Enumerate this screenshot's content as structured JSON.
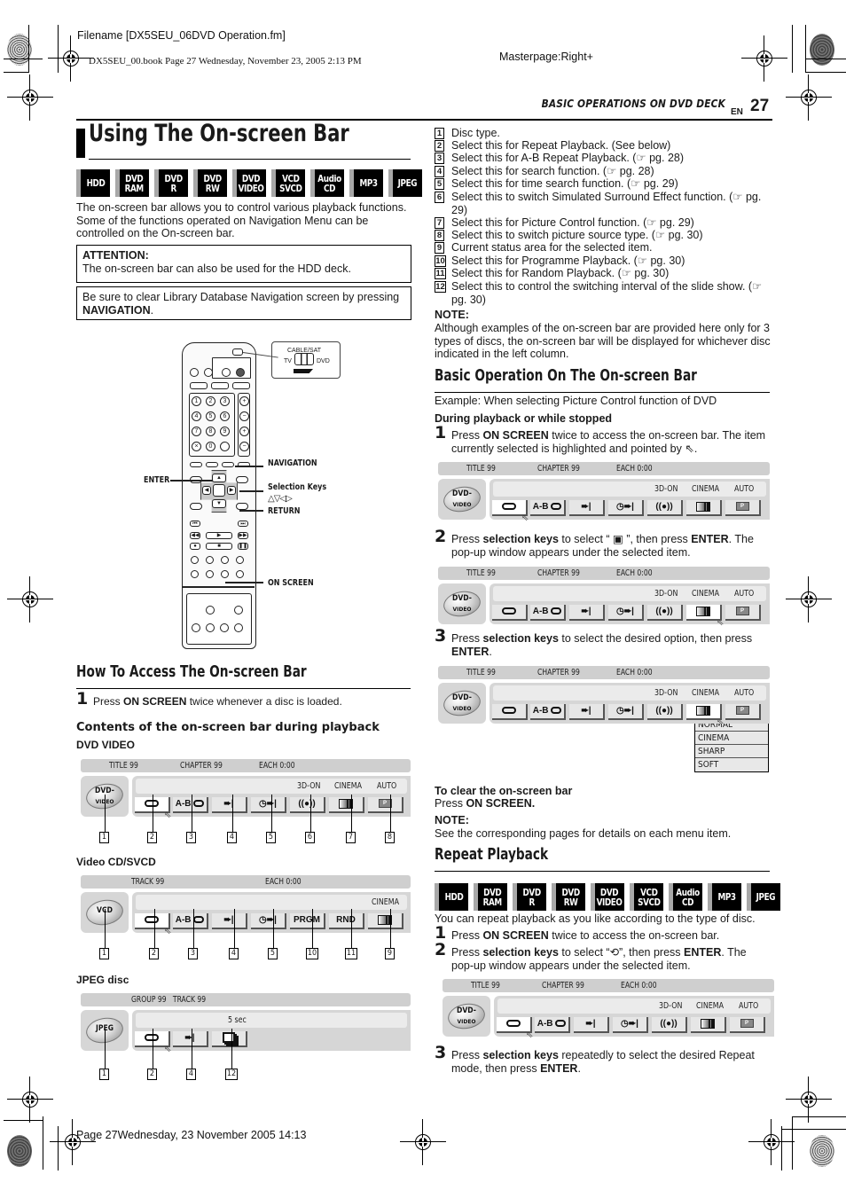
{
  "print_header": {
    "filename": "Filename [DX5SEU_06DVD Operation.fm]",
    "book_info": "DX5SEU_00.book  Page 27  Wednesday, November 23, 2005  2:13 PM",
    "masterpage": "Masterpage:Right+"
  },
  "page_header": {
    "section": "BASIC OPERATIONS ON DVD DECK",
    "lang": "EN",
    "page_number": "27"
  },
  "print_footer": {
    "text": "Page 27Wednesday, 23 November 2005  14:13"
  },
  "main": {
    "title": "Using The On-screen Bar",
    "disc_badges": [
      "HDD",
      "DVD\nRAM",
      "DVD\nR",
      "DVD\nRW",
      "DVD\nVIDEO",
      "VCD\nSVCD",
      "Audio\nCD",
      "MP3",
      "JPEG"
    ],
    "intro": "The on-screen bar allows you to control various playback functions. Some of the functions operated on Navigation Menu can be controlled on the On-screen bar.",
    "attention": {
      "label": "ATTENTION:",
      "text": "The on-screen bar can also be used for the HDD deck."
    },
    "notice": {
      "text": "Be sure to clear Library Database Navigation screen by pressing ",
      "bold": "NAVIGATION",
      "end": "."
    }
  },
  "remote": {
    "switch_title": "CABLE/SAT",
    "switch_left": "TV",
    "switch_right": "DVD",
    "labels": {
      "navigation": "NAVIGATION",
      "enter": "ENTER",
      "selection_keys": "Selection Keys",
      "selection_arrows": "△▽◁▷",
      "return": "RETURN",
      "on_screen": "ON SCREEN"
    },
    "number_keys": [
      "1",
      "2",
      "3",
      "4",
      "5",
      "6",
      "7",
      "8",
      "9",
      "×",
      "0",
      ""
    ]
  },
  "how_to_access": {
    "title": "How To Access The On-screen Bar",
    "step1": {
      "num": "1",
      "pre": "Press ",
      "bold": "ON SCREEN",
      "post": " twice whenever a disc is loaded."
    },
    "contents_title": "Contents of the on-screen bar during playback",
    "dvd_label": "DVD VIDEO",
    "vcd_label": "Video CD/SVCD",
    "jpeg_label": "JPEG disc"
  },
  "bars": {
    "dvd": {
      "top": [
        "TITLE 99",
        "CHAPTER 99",
        "EACH 0:00"
      ],
      "status": [
        "3D-ON",
        "CINEMA",
        "AUTO"
      ],
      "disc": "DVD-",
      "disc_sub": "VIDEO",
      "buttons": [
        "repeat",
        "A-B",
        "search",
        "time-search",
        "surround",
        "picture",
        "source"
      ],
      "callouts": [
        "1",
        "2",
        "3",
        "4",
        "5",
        "6",
        "7",
        "8"
      ]
    },
    "vcd": {
      "top": [
        "TRACK 99",
        "EACH 0:00"
      ],
      "status": [
        "CINEMA"
      ],
      "disc": "VCD",
      "prgm": "PRGM",
      "rnd": "RND",
      "callouts": [
        "1",
        "2",
        "3",
        "4",
        "5",
        "10",
        "11",
        "9"
      ]
    },
    "jpeg": {
      "top": [
        "GROUP 99   TRACK 99"
      ],
      "status": [
        "5 sec"
      ],
      "disc": "JPEG",
      "callouts": [
        "1",
        "2",
        "4",
        "12"
      ]
    },
    "ab_label": "A-B"
  },
  "legend": [
    {
      "num": "1",
      "text": "Disc type."
    },
    {
      "num": "2",
      "text": "Select this for Repeat Playback. (See below)"
    },
    {
      "num": "3",
      "text": "Select this for A-B Repeat Playback. (☞ pg. 28)"
    },
    {
      "num": "4",
      "text": "Select this for search function. (☞ pg. 28)"
    },
    {
      "num": "5",
      "text": "Select this for time search function. (☞ pg. 29)"
    },
    {
      "num": "6",
      "text": "Select this to switch Simulated Surround Effect function. (☞ pg. 29)"
    },
    {
      "num": "7",
      "text": "Select this for Picture Control function. (☞ pg. 29)"
    },
    {
      "num": "8",
      "text": "Select this to switch picture source type. (☞ pg. 30)"
    },
    {
      "num": "9",
      "text": "Current status area for the selected item."
    },
    {
      "num": "10",
      "text": "Select this for Programme Playback. (☞ pg. 30)"
    },
    {
      "num": "11",
      "text": "Select this for Random Playback. (☞ pg. 30)"
    },
    {
      "num": "12",
      "text": "Select this to control the switching interval of the slide show. (☞ pg. 30)"
    }
  ],
  "note1": {
    "label": "NOTE:",
    "text": "Although examples of the on-screen bar are provided here only for 3 types of discs, the on-screen bar will be displayed for whichever disc indicated in the left column."
  },
  "basic_op": {
    "title": "Basic Operation On The On-screen Bar",
    "example": "Example: When selecting Picture Control function of DVD",
    "subhead": "During playback or while stopped",
    "step1": {
      "num": "1",
      "pre": "Press ",
      "bold": "ON SCREEN",
      "post": " twice to access the on-screen bar. The item currently selected is highlighted and pointed by ⇖."
    },
    "step2": {
      "num": "2",
      "pre": "Press ",
      "bold": "selection keys",
      "mid": " to select “ ▣ ”, then press ",
      "bold2": "ENTER",
      "post": ". The pop-up window appears under the selected item."
    },
    "step3": {
      "num": "3",
      "pre": "Press ",
      "bold": "selection keys",
      "mid": " to select the desired option, then press ",
      "bold2": "ENTER",
      "post": "."
    },
    "popup_options": [
      "NORMAL",
      "CINEMA",
      "SHARP",
      "SOFT"
    ],
    "clear_title": "To clear the on-screen bar",
    "clear_pre": "Press ",
    "clear_bold": "ON SCREEN.",
    "note_label": "NOTE:",
    "note_text": "See the corresponding pages for details on each menu item."
  },
  "repeat": {
    "title": "Repeat Playback",
    "intro": "You can repeat playback as you like according to the type of disc.",
    "step1": {
      "num": "1",
      "pre": "Press ",
      "bold": "ON SCREEN",
      "post": " twice to access the on-screen bar."
    },
    "step2": {
      "num": "2",
      "pre": "Press ",
      "bold": "selection keys",
      "mid": " to select “⟲”, then press ",
      "bold2": "ENTER",
      "post": ". The pop-up window appears under the selected item."
    },
    "step3": {
      "num": "3",
      "pre": "Press ",
      "bold": "selection keys",
      "mid": " repeatedly to select the desired Repeat mode, then press ",
      "bold2": "ENTER",
      "post": "."
    }
  }
}
